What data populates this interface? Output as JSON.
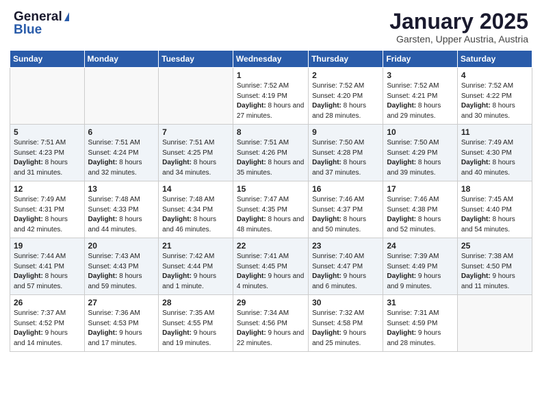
{
  "logo": {
    "general": "General",
    "blue": "Blue"
  },
  "header": {
    "month": "January 2025",
    "location": "Garsten, Upper Austria, Austria"
  },
  "weekdays": [
    "Sunday",
    "Monday",
    "Tuesday",
    "Wednesday",
    "Thursday",
    "Friday",
    "Saturday"
  ],
  "weeks": [
    [
      {
        "day": "",
        "text": ""
      },
      {
        "day": "",
        "text": ""
      },
      {
        "day": "",
        "text": ""
      },
      {
        "day": "1",
        "text": "Sunrise: 7:52 AM\nSunset: 4:19 PM\nDaylight: 8 hours and 27 minutes."
      },
      {
        "day": "2",
        "text": "Sunrise: 7:52 AM\nSunset: 4:20 PM\nDaylight: 8 hours and 28 minutes."
      },
      {
        "day": "3",
        "text": "Sunrise: 7:52 AM\nSunset: 4:21 PM\nDaylight: 8 hours and 29 minutes."
      },
      {
        "day": "4",
        "text": "Sunrise: 7:52 AM\nSunset: 4:22 PM\nDaylight: 8 hours and 30 minutes."
      }
    ],
    [
      {
        "day": "5",
        "text": "Sunrise: 7:51 AM\nSunset: 4:23 PM\nDaylight: 8 hours and 31 minutes."
      },
      {
        "day": "6",
        "text": "Sunrise: 7:51 AM\nSunset: 4:24 PM\nDaylight: 8 hours and 32 minutes."
      },
      {
        "day": "7",
        "text": "Sunrise: 7:51 AM\nSunset: 4:25 PM\nDaylight: 8 hours and 34 minutes."
      },
      {
        "day": "8",
        "text": "Sunrise: 7:51 AM\nSunset: 4:26 PM\nDaylight: 8 hours and 35 minutes."
      },
      {
        "day": "9",
        "text": "Sunrise: 7:50 AM\nSunset: 4:28 PM\nDaylight: 8 hours and 37 minutes."
      },
      {
        "day": "10",
        "text": "Sunrise: 7:50 AM\nSunset: 4:29 PM\nDaylight: 8 hours and 39 minutes."
      },
      {
        "day": "11",
        "text": "Sunrise: 7:49 AM\nSunset: 4:30 PM\nDaylight: 8 hours and 40 minutes."
      }
    ],
    [
      {
        "day": "12",
        "text": "Sunrise: 7:49 AM\nSunset: 4:31 PM\nDaylight: 8 hours and 42 minutes."
      },
      {
        "day": "13",
        "text": "Sunrise: 7:48 AM\nSunset: 4:33 PM\nDaylight: 8 hours and 44 minutes."
      },
      {
        "day": "14",
        "text": "Sunrise: 7:48 AM\nSunset: 4:34 PM\nDaylight: 8 hours and 46 minutes."
      },
      {
        "day": "15",
        "text": "Sunrise: 7:47 AM\nSunset: 4:35 PM\nDaylight: 8 hours and 48 minutes."
      },
      {
        "day": "16",
        "text": "Sunrise: 7:46 AM\nSunset: 4:37 PM\nDaylight: 8 hours and 50 minutes."
      },
      {
        "day": "17",
        "text": "Sunrise: 7:46 AM\nSunset: 4:38 PM\nDaylight: 8 hours and 52 minutes."
      },
      {
        "day": "18",
        "text": "Sunrise: 7:45 AM\nSunset: 4:40 PM\nDaylight: 8 hours and 54 minutes."
      }
    ],
    [
      {
        "day": "19",
        "text": "Sunrise: 7:44 AM\nSunset: 4:41 PM\nDaylight: 8 hours and 57 minutes."
      },
      {
        "day": "20",
        "text": "Sunrise: 7:43 AM\nSunset: 4:43 PM\nDaylight: 8 hours and 59 minutes."
      },
      {
        "day": "21",
        "text": "Sunrise: 7:42 AM\nSunset: 4:44 PM\nDaylight: 9 hours and 1 minute."
      },
      {
        "day": "22",
        "text": "Sunrise: 7:41 AM\nSunset: 4:45 PM\nDaylight: 9 hours and 4 minutes."
      },
      {
        "day": "23",
        "text": "Sunrise: 7:40 AM\nSunset: 4:47 PM\nDaylight: 9 hours and 6 minutes."
      },
      {
        "day": "24",
        "text": "Sunrise: 7:39 AM\nSunset: 4:49 PM\nDaylight: 9 hours and 9 minutes."
      },
      {
        "day": "25",
        "text": "Sunrise: 7:38 AM\nSunset: 4:50 PM\nDaylight: 9 hours and 11 minutes."
      }
    ],
    [
      {
        "day": "26",
        "text": "Sunrise: 7:37 AM\nSunset: 4:52 PM\nDaylight: 9 hours and 14 minutes."
      },
      {
        "day": "27",
        "text": "Sunrise: 7:36 AM\nSunset: 4:53 PM\nDaylight: 9 hours and 17 minutes."
      },
      {
        "day": "28",
        "text": "Sunrise: 7:35 AM\nSunset: 4:55 PM\nDaylight: 9 hours and 19 minutes."
      },
      {
        "day": "29",
        "text": "Sunrise: 7:34 AM\nSunset: 4:56 PM\nDaylight: 9 hours and 22 minutes."
      },
      {
        "day": "30",
        "text": "Sunrise: 7:32 AM\nSunset: 4:58 PM\nDaylight: 9 hours and 25 minutes."
      },
      {
        "day": "31",
        "text": "Sunrise: 7:31 AM\nSunset: 4:59 PM\nDaylight: 9 hours and 28 minutes."
      },
      {
        "day": "",
        "text": ""
      }
    ]
  ]
}
